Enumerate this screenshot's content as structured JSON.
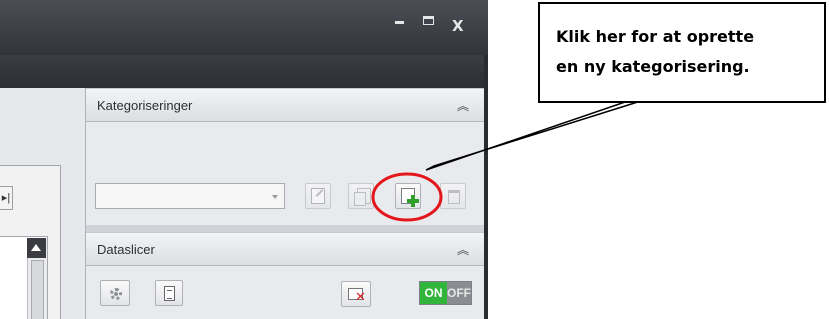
{
  "window": {
    "controls": {
      "minimize_icon": "minimize-icon",
      "maximize_icon": "maximize-icon",
      "close_label": "X"
    }
  },
  "kategoriseringer": {
    "title": "Kategoriseringer",
    "collapse_glyph": "»",
    "combo_value": "",
    "buttons": [
      "edit-icon",
      "copy-icon",
      "add-category-icon",
      "trash-icon"
    ]
  },
  "dataslicer": {
    "title": "Dataslicer",
    "collapse_glyph": "»",
    "toggle_on": "ON",
    "toggle_off": "OFF",
    "buttons": [
      "gear-icon",
      "document-icon",
      "clear-filter-icon"
    ]
  },
  "annotation": {
    "text_line1": "Klik her for at oprette",
    "text_line2": "en ny kategorisering.",
    "highlight_color": "#e3161b"
  },
  "colors": {
    "toggle_on": "#31b53b",
    "plus": "#2fa12b",
    "titlebar": "#3b3d43"
  }
}
